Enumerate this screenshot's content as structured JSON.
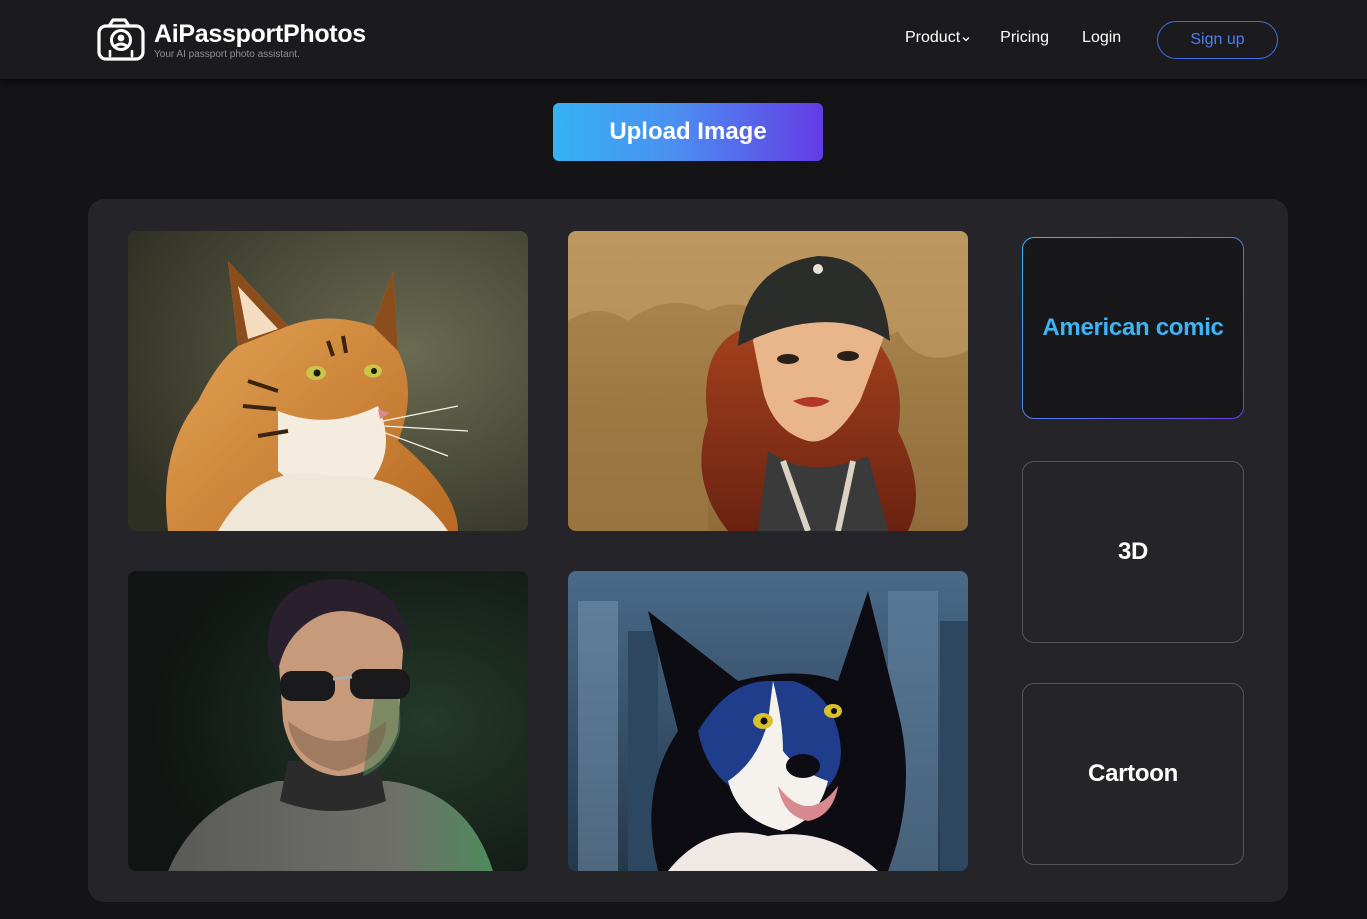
{
  "header": {
    "brand_name": "AiPassportPhotos",
    "brand_tagline": "Your AI passport photo assistant.",
    "nav": {
      "product": "Product",
      "pricing": "Pricing",
      "login": "Login"
    },
    "signup_label": "Sign up"
  },
  "upload_label": "Upload Image",
  "gallery": {
    "images": [
      {
        "subject": "comic-style lynx cat"
      },
      {
        "subject": "comic-style woman in beanie"
      },
      {
        "subject": "comic-style man in sunglasses"
      },
      {
        "subject": "comic-style border collie"
      }
    ]
  },
  "styles": [
    {
      "label": "American comic",
      "active": true
    },
    {
      "label": "3D",
      "active": false
    },
    {
      "label": "Cartoon",
      "active": false
    }
  ],
  "colors": {
    "accent_blue": "#3fb4f4",
    "accent_purple": "#633be5",
    "signup_blue": "#4d7ef2"
  }
}
